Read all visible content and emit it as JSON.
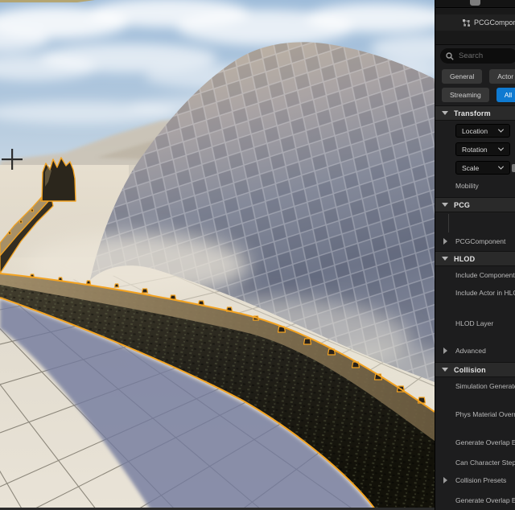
{
  "window": {
    "app": "Unreal Engine Editor",
    "view": "Level viewport with Details panel"
  },
  "colors": {
    "selection_outline": "#F3A322",
    "accent_blue": "#0F7AD1",
    "panel_background": "#1D1D1E",
    "section_header_background": "#2A2A2A",
    "sky_top": "#9DBBD9",
    "wall_shadow": "#727A9E"
  },
  "icons": {
    "search": "magnifier-icon",
    "pcg_component": "node-graph-icon",
    "expand_collapsed": "triangle-right-icon",
    "expand_expanded": "triangle-down-icon",
    "dropdown": "chevron-down-icon",
    "viewport_cursor": "crosshair-icon",
    "lock": "lock-icon-partial"
  },
  "viewport": {
    "cursor": "crosshair",
    "selected_object": "wall spline with orange selection outline"
  },
  "panel": {
    "component_row": {
      "label": "PCGComponent"
    },
    "search": {
      "placeholder": "Search"
    },
    "filters": {
      "general": "General",
      "actor": "Actor",
      "streaming": "Streaming",
      "all": "All",
      "active": "All"
    },
    "transform": {
      "title": "Transform",
      "location": "Location",
      "rotation": "Rotation",
      "scale": "Scale",
      "mobility": "Mobility"
    },
    "pcg": {
      "title": "PCG",
      "component": "PCGComponent"
    },
    "hlod": {
      "title": "HLOD",
      "include_component": "Include Component in HLOD",
      "include_actor": "Include Actor in HLOD",
      "hlod_layer": "HLOD Layer",
      "advanced": "Advanced"
    },
    "collision": {
      "title": "Collision",
      "simulation_generates": "Simulation Generates Hit Events",
      "phys_material": "Phys Material Override",
      "generate_overlap": "Generate Overlap Events",
      "can_character_step": "Can Character Step Up On",
      "collision_presets": "Collision Presets",
      "generate_overlap_2": "Generate Overlap Events"
    }
  }
}
